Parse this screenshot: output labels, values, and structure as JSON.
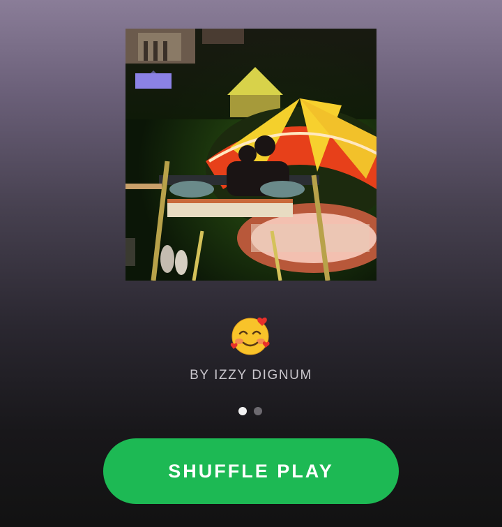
{
  "playlist": {
    "cover_image": "carousel-ride-at-night",
    "title_emoji": "🥰",
    "byline": "BY IZZY DIGNUM"
  },
  "pagination": {
    "total": 2,
    "active_index": 0
  },
  "actions": {
    "shuffle_label": "SHUFFLE PLAY"
  },
  "colors": {
    "accent": "#1db954",
    "dot_active": "#f2f2f2",
    "dot_inactive": "#6d6a70"
  }
}
